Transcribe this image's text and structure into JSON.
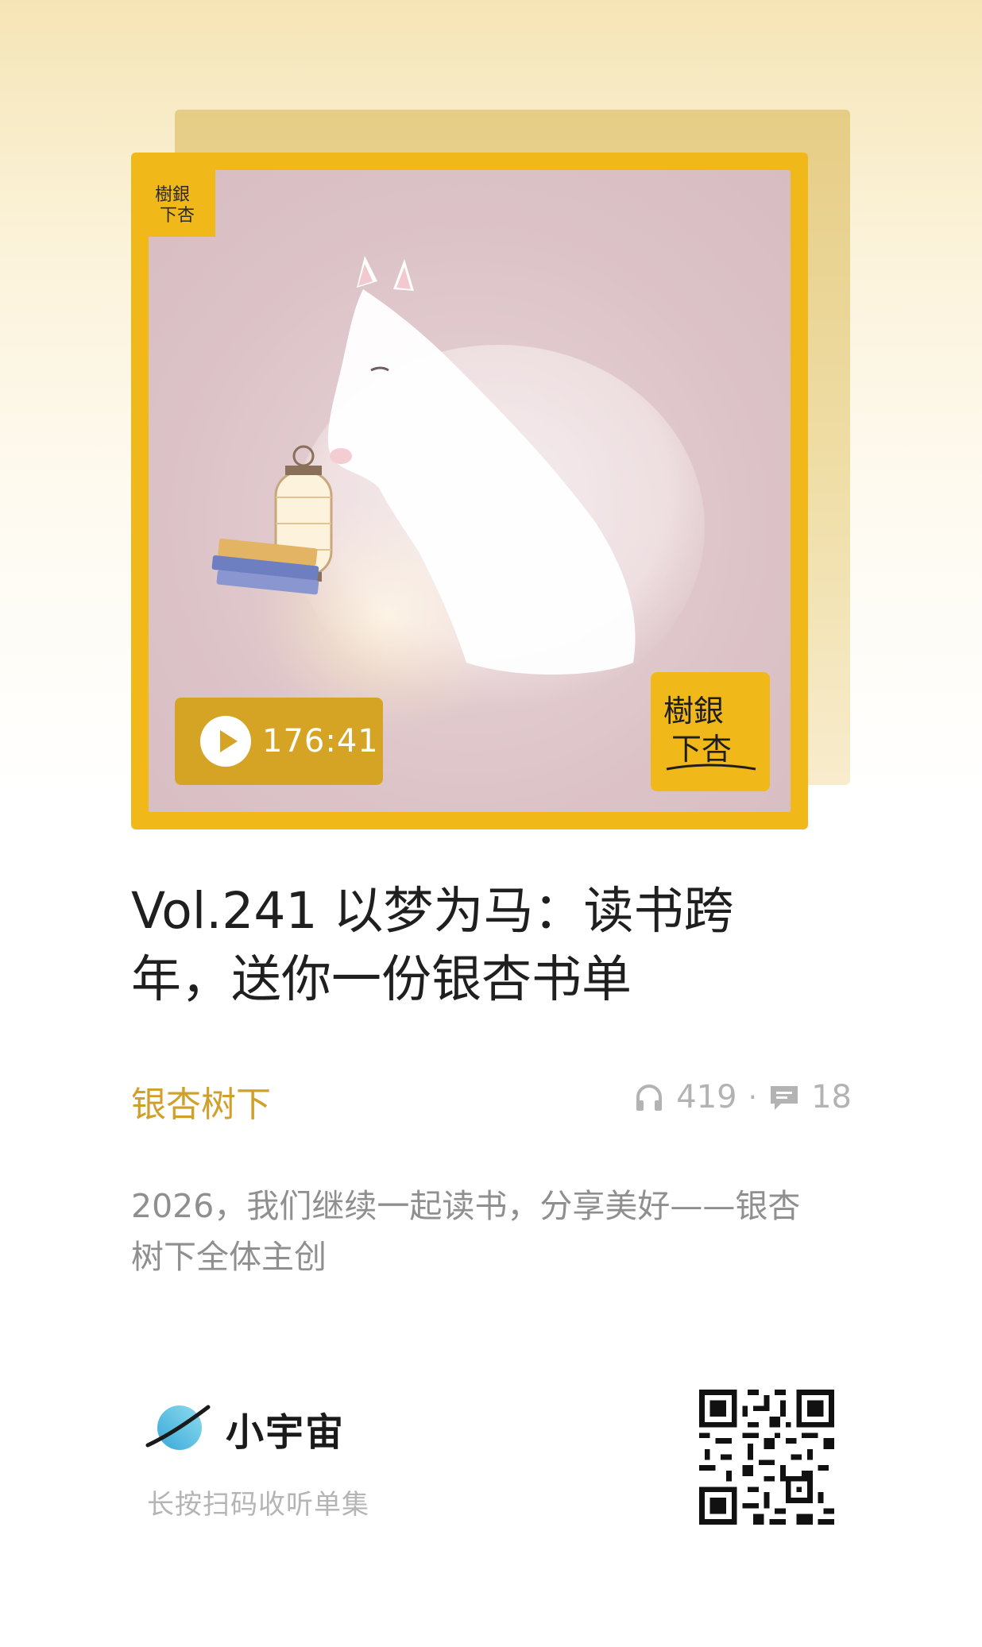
{
  "cover": {
    "logo_text": "银杏树下",
    "duration": "176:41"
  },
  "episode": {
    "title": "Vol.241 以梦为马：读书跨年，送你一份银杏书单",
    "podcast_name": "银杏树下",
    "plays": "419",
    "comments": "18",
    "description": "2026，我们继续一起读书，分享美好——银杏树下全体主创"
  },
  "footer": {
    "brand": "小宇宙",
    "hint": "长按扫码收听单集"
  },
  "colors": {
    "accent": "#f0b819",
    "podcast_name": "#d1a02a",
    "play_pill": "#d6a425",
    "muted": "#b3b3b3"
  },
  "icons": [
    "play-icon",
    "headphones-icon",
    "comment-icon",
    "planet-icon",
    "qr-code"
  ]
}
